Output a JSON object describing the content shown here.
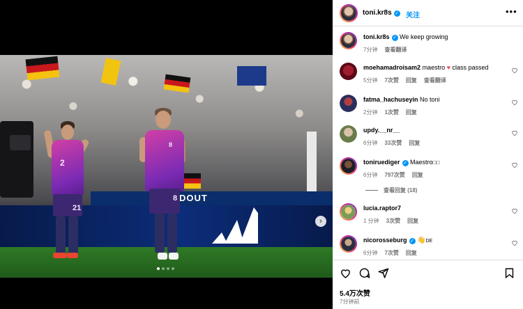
{
  "header": {
    "username": "toni.kr8s",
    "follow_label": "关注",
    "more_icon": "more-horizontal-icon"
  },
  "caption": {
    "username": "toni.kr8s",
    "text": "We keep growing",
    "time": "7分钟",
    "translate": "查看翻译"
  },
  "comments": [
    {
      "username": "moehamadroisam2",
      "text": "maestro",
      "emoji": "red-heart",
      "text2": "class passed",
      "time": "5分钟",
      "likes": "7次赞",
      "reply": "回复",
      "translate": "查看翻译",
      "verified": false
    },
    {
      "username": "fatma_hachuseyin",
      "text": "No toni",
      "time": "2分钟",
      "likes": "1次赞",
      "reply": "回复",
      "verified": false
    },
    {
      "username": "updy.__nr__",
      "text": "",
      "time": "6分钟",
      "likes": "33次赞",
      "reply": "回复",
      "verified": false
    },
    {
      "username": "toniruediger",
      "text": "Maestro",
      "time": "6分钟",
      "likes": "797次赞",
      "reply": "回复",
      "verified": true
    },
    {
      "username": "lucia.raptor7",
      "text": "",
      "time": "1 分钟",
      "likes": "3次赞",
      "reply": "回复",
      "verified": false
    },
    {
      "username": "nicorosseburg",
      "text": "DE",
      "time": "6分钟",
      "likes": "7次赞",
      "reply": "回复",
      "verified": true
    }
  ],
  "view_replies": "查看回复 (18)",
  "footer": {
    "likes": "5.4万次赞",
    "time_ago": "7分钟前"
  },
  "photo": {
    "banner_text": "DOUT",
    "player_left_number": "21",
    "player_right_number": "8",
    "jersey_number_small_left": "2",
    "jersey_number_small_right": "8",
    "carousel": {
      "count": 4,
      "active": 1
    }
  },
  "colors": {
    "accent": "#0095f6",
    "verified": "#0095f6",
    "heart": "#ed4956",
    "secondary_text": "#737373"
  }
}
